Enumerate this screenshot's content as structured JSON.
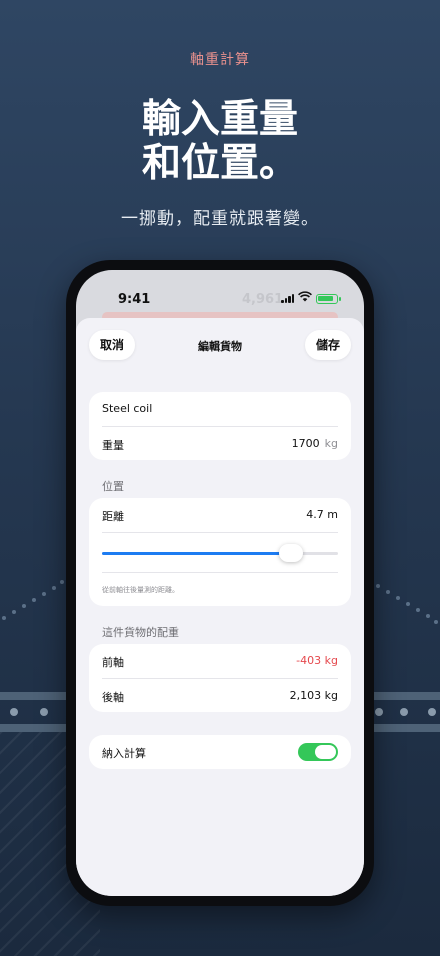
{
  "marketing": {
    "eyebrow": "軸重計算",
    "headline_line1": "輸入重量",
    "headline_line2": "和位置。",
    "subheadline": "一挪動，配重就跟著變。"
  },
  "status_bar": {
    "time": "9:41",
    "background_value": "4,961"
  },
  "sheet": {
    "cancel_label": "取消",
    "title": "編輯貨物",
    "save_label": "儲存"
  },
  "cargo": {
    "name": "Steel coil",
    "weight_label": "重量",
    "weight_value": "1700",
    "weight_unit": "kg"
  },
  "position": {
    "section_label": "位置",
    "distance_label": "距離",
    "distance_value": "4.7 m",
    "slider_fraction": 0.8,
    "hint": "從前軸往後量測的距離。"
  },
  "distribution": {
    "section_label": "這件貨物的配重",
    "front_label": "前軸",
    "front_value": "-403 kg",
    "rear_label": "後軸",
    "rear_value": "2,103 kg"
  },
  "include": {
    "label": "納入計算",
    "enabled": true
  },
  "colors": {
    "accent": "#1d7cf2",
    "negative": "#e5484d",
    "toggle_on": "#34c759",
    "eyebrow": "#e9918e"
  }
}
